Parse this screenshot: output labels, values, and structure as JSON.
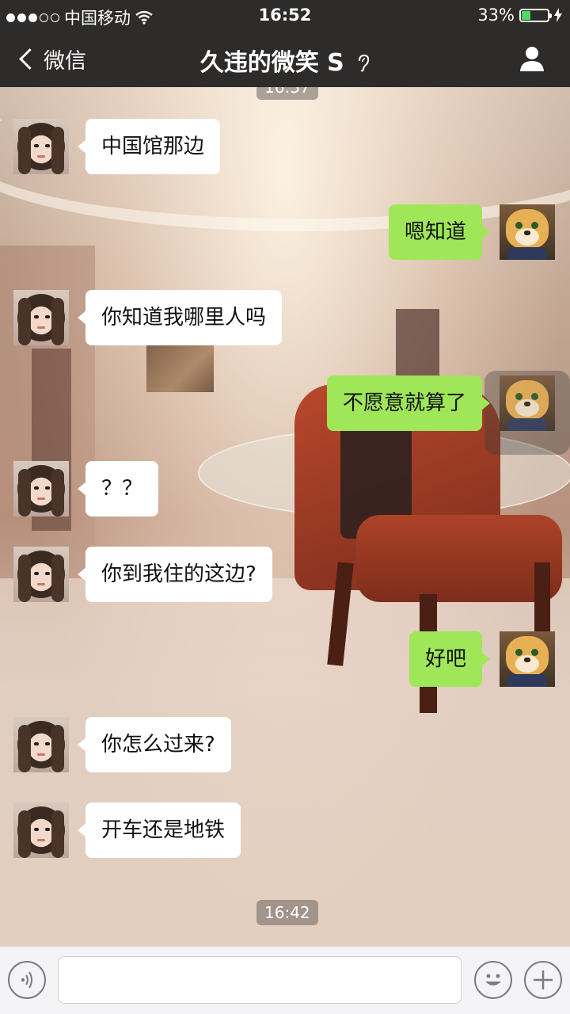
{
  "status_bar": {
    "carrier": "中国移动",
    "time": "16:52",
    "battery_percent": "33%",
    "battery_level": 0.33,
    "signal_bars_filled": 3,
    "signal_bars_total": 5
  },
  "nav": {
    "back_label": "微信",
    "title": "久违的微笑 S",
    "earpiece_mode_icon": "ear-icon",
    "profile_icon": "person-icon"
  },
  "timestamps": {
    "top_partial": "16:37",
    "bottom": "16:42"
  },
  "messages": [
    {
      "from": "them",
      "text": "中国馆那边"
    },
    {
      "from": "me",
      "text": "嗯知道"
    },
    {
      "from": "them",
      "text": "你知道我哪里人吗"
    },
    {
      "from": "me",
      "text": "不愿意就算了"
    },
    {
      "from": "them",
      "text": "？？"
    },
    {
      "from": "them",
      "text": "你到我住的这边?"
    },
    {
      "from": "me",
      "text": "好吧"
    },
    {
      "from": "them",
      "text": "你怎么过来?"
    },
    {
      "from": "them",
      "text": "开车还是地铁"
    }
  ],
  "input": {
    "value": "",
    "voice_icon": "voice-icon",
    "emoji_icon": "emoji-icon",
    "plus_icon": "plus-icon"
  },
  "colors": {
    "bar_bg": "#2e2c2b",
    "outgoing_bubble": "#9fe658",
    "incoming_bubble": "#ffffff",
    "battery_fill": "#4cd964"
  }
}
